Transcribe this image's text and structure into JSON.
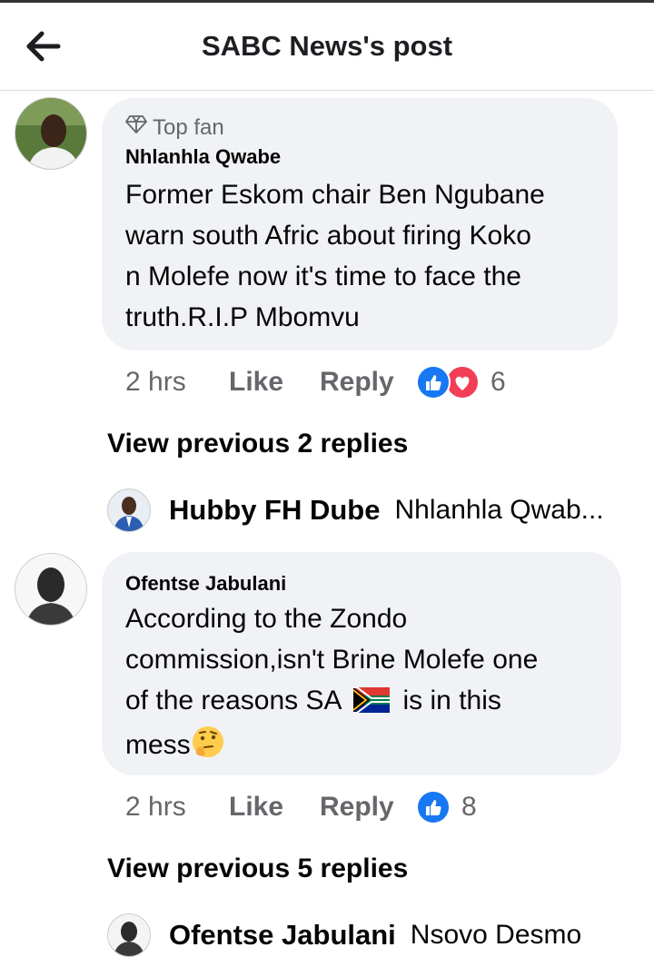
{
  "header": {
    "title": "SABC News's post"
  },
  "comments": [
    {
      "badge": "Top fan",
      "name": "Nhlanhla Qwabe",
      "lines": [
        "Former Eskom chair Ben Ngubane",
        "warn south Afric about firing Koko",
        "n Molefe now it's time to face the",
        "truth.R.I.P Mbomvu"
      ],
      "time": "2 hrs",
      "like_label": "Like",
      "reply_label": "Reply",
      "reaction_count": "6",
      "view_previous": "View previous 2 replies",
      "latest_reply": {
        "name": "Hubby FH Dube",
        "text": "Nhlanhla Qwab..."
      }
    },
    {
      "name": "Ofentse Jabulani",
      "lines": [
        "According to the Zondo",
        "commission,isn't Brine Molefe one",
        "of the reasons SA",
        "is in this",
        "mess"
      ],
      "time": "2 hrs",
      "like_label": "Like",
      "reply_label": "Reply",
      "reaction_count": "8",
      "view_previous": "View previous 5 replies",
      "latest_reply": {
        "name": "Ofentse Jabulani",
        "text": "Nsovo Desmo"
      }
    }
  ],
  "colors": {
    "like_blue": "#1877f2",
    "love_red": "#f33e58",
    "bubble_bg": "#f0f2f5",
    "meta_gray": "#65676b"
  }
}
